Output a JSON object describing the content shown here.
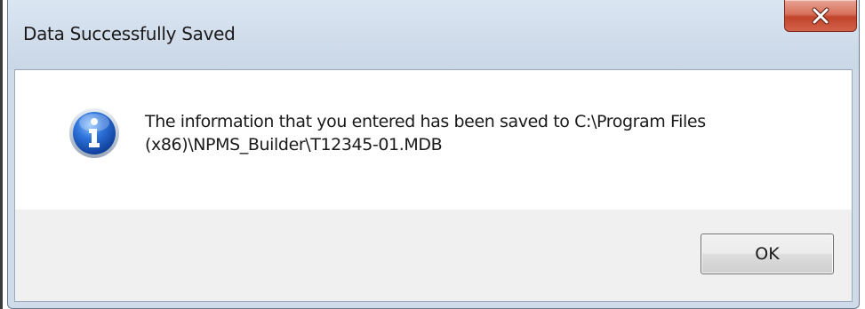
{
  "window": {
    "title": "Data Successfully Saved",
    "close_icon": "close-icon"
  },
  "message": {
    "icon": "info-icon",
    "text": "The information that you entered has been saved to C:\\Program Files (x86)\\NPMS_Builder\\T12345-01.MDB"
  },
  "buttons": {
    "ok_label": "OK"
  },
  "colors": {
    "close_button": "#c9503a",
    "info_icon": "#2a6ad3",
    "frame": "#cfdbe9"
  }
}
